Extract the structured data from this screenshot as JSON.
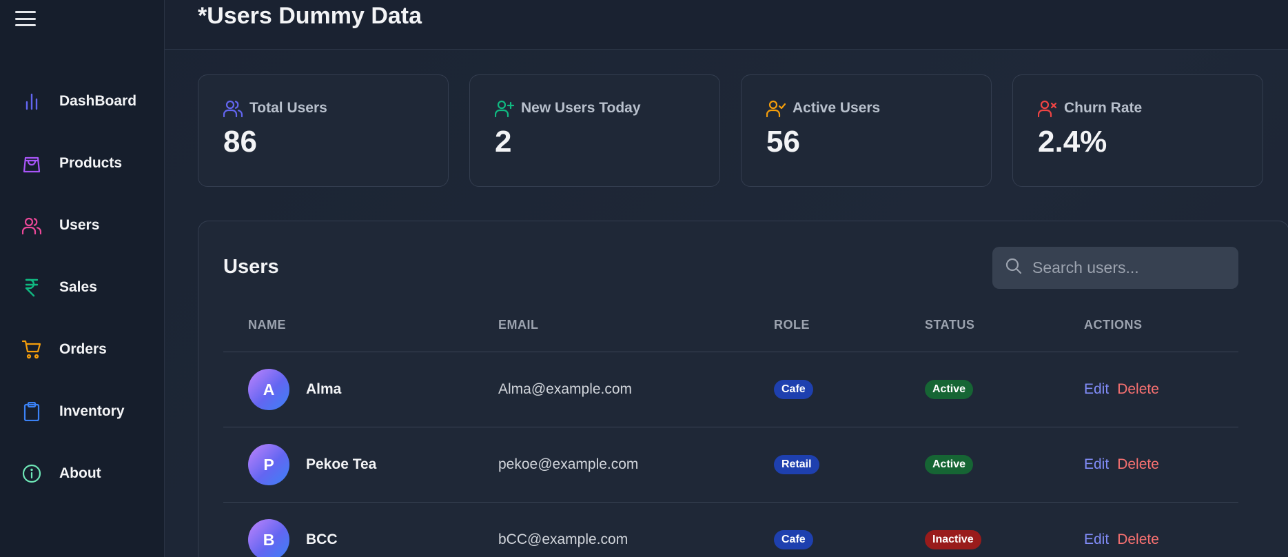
{
  "header": {
    "title": "*Users Dummy Data"
  },
  "sidebar": {
    "items": [
      {
        "label": "DashBoard",
        "icon": "bar-chart-icon",
        "color": "#6366f1"
      },
      {
        "label": "Products",
        "icon": "shopping-bag-icon",
        "color": "#a855f7"
      },
      {
        "label": "Users",
        "icon": "users-icon",
        "color": "#ec4899"
      },
      {
        "label": "Sales",
        "icon": "rupee-icon",
        "color": "#10b981"
      },
      {
        "label": "Orders",
        "icon": "cart-icon",
        "color": "#f59e0b"
      },
      {
        "label": "Inventory",
        "icon": "clipboard-icon",
        "color": "#3b82f6"
      },
      {
        "label": "About",
        "icon": "info-icon",
        "color": "#6ee7b7"
      }
    ]
  },
  "stats": [
    {
      "label": "Total Users",
      "value": "86",
      "icon": "users-icon",
      "color": "#6366f1"
    },
    {
      "label": "New Users Today",
      "value": "2",
      "icon": "user-plus-icon",
      "color": "#10b981"
    },
    {
      "label": "Active Users",
      "value": "56",
      "icon": "user-check-icon",
      "color": "#f59e0b"
    },
    {
      "label": "Churn Rate",
      "value": "2.4%",
      "icon": "user-x-icon",
      "color": "#ef4444"
    }
  ],
  "users_table": {
    "title": "Users",
    "search_placeholder": "Search users...",
    "columns": [
      "NAME",
      "EMAIL",
      "ROLE",
      "STATUS",
      "ACTIONS"
    ],
    "edit_label": "Edit",
    "delete_label": "Delete",
    "rows": [
      {
        "initial": "A",
        "name": "Alma",
        "email": "Alma@example.com",
        "role": "Cafe",
        "status": "Active"
      },
      {
        "initial": "P",
        "name": "Pekoe Tea",
        "email": "pekoe@example.com",
        "role": "Retail",
        "status": "Active"
      },
      {
        "initial": "B",
        "name": "BCC",
        "email": "bCC@example.com",
        "role": "Cafe",
        "status": "Inactive"
      }
    ]
  },
  "colors": {
    "role_badge": "#1e40af",
    "status_active": "#166534",
    "status_inactive": "#991b1b",
    "edit_link": "#818cf8",
    "delete_link": "#f87171"
  }
}
